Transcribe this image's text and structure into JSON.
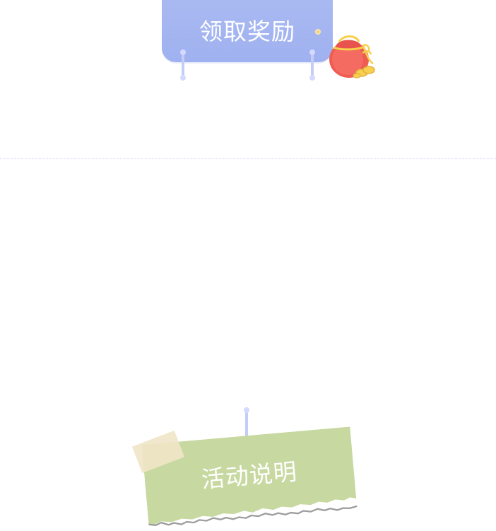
{
  "claim_button": {
    "label": "领取奖励"
  },
  "activity_note": {
    "label": "活动说明"
  },
  "colors": {
    "claim_button_bg": "#9fb1f0",
    "leg": "#c4cdfa",
    "knob": "#d5d9ff",
    "separator": "#d9dcff",
    "note_bg": "#c7d9a0",
    "tape": "#f0e4c7",
    "bag_red": "#f05b52"
  },
  "icons": {
    "reward_bag": "red-lucky-bag-icon",
    "claim_dot": "yellow-dot-icon"
  }
}
